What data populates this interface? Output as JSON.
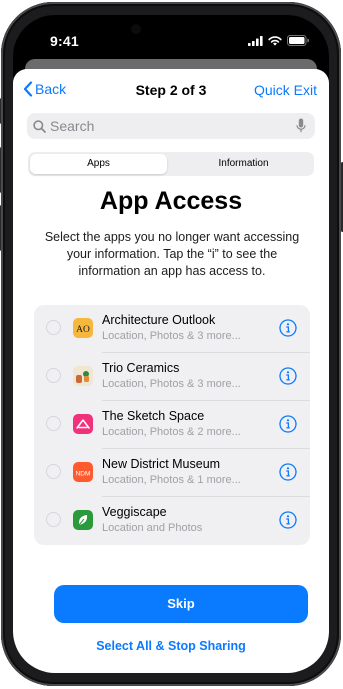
{
  "status_bar": {
    "time": "9:41",
    "icons": [
      "signal-icon",
      "wifi-icon",
      "battery-icon"
    ]
  },
  "nav": {
    "back_label": "Back",
    "title": "Step 2 of 3",
    "quick_exit_label": "Quick Exit"
  },
  "search": {
    "placeholder": "Search",
    "value": ""
  },
  "segmented": {
    "options": [
      "Apps",
      "Information"
    ],
    "selected": "Apps"
  },
  "heading": "App Access",
  "description": "Select the apps you no longer want accessing your information. Tap the “i” to see the information an app has access to.",
  "apps": [
    {
      "name": "Architecture Outlook",
      "detail": "Location, Photos & 3 more...",
      "icon": "architecture-outlook-icon",
      "icon_text": "AO",
      "selected": false
    },
    {
      "name": "Trio Ceramics",
      "detail": "Location, Photos & 3 more...",
      "icon": "trio-ceramics-icon",
      "selected": false
    },
    {
      "name": "The Sketch Space",
      "detail": "Location, Photos & 2 more...",
      "icon": "sketch-space-icon",
      "selected": false
    },
    {
      "name": "New District Museum",
      "detail": "Location, Photos & 1 more...",
      "icon": "new-district-museum-icon",
      "icon_text": "NDM",
      "selected": false
    },
    {
      "name": "Veggiscape",
      "detail": "Location and Photos",
      "icon": "veggiscape-icon",
      "selected": false
    }
  ],
  "actions": {
    "skip_label": "Skip",
    "select_all_label": "Select All & Stop Sharing"
  },
  "colors": {
    "accent": "#0A7AFF",
    "sheet_background": "#FFFFFF",
    "list_background": "#F0F0F2"
  }
}
